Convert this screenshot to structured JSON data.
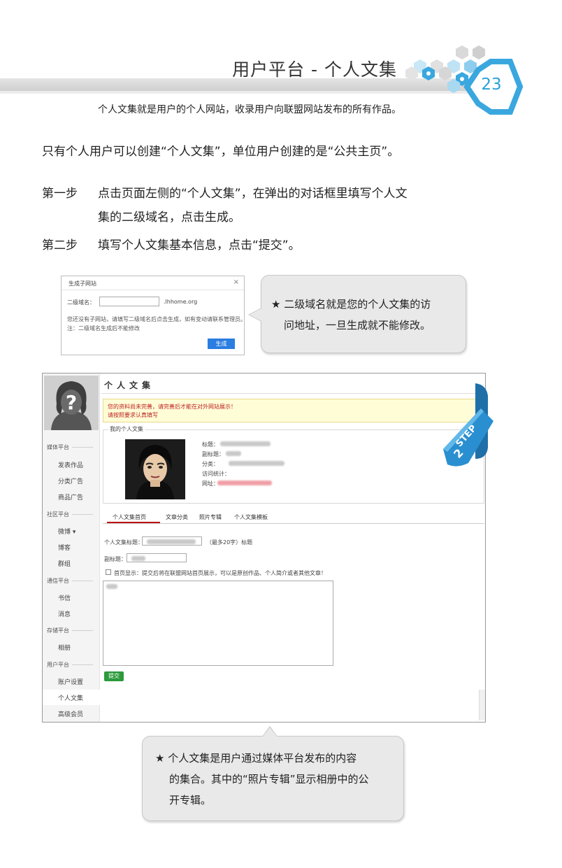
{
  "header": {
    "title": "用户平台 - 个人文集",
    "page_number": "23",
    "subtitle": "个人文集就是用户的个人网站，收录用户向联盟网站发布的所有作品。",
    "accent_color": "#2a9fd9"
  },
  "body": {
    "intro": "只有个人用户可以创建“个人文集”，单位用户创建的是“公共主页”。",
    "step1_label": "第一步",
    "step1_line1": "点击页面左侧的“个人文集”，在弹出的对话框里填写个人文",
    "step1_line2": "集的二级域名，点击生成。",
    "step2_label": "第二步",
    "step2_text": "填写个人文集基本信息，点击“提交”。"
  },
  "dialog": {
    "title": "生成子网站",
    "close": "×",
    "field_label": "二级域名：",
    "suffix": ".lhhome.org",
    "tip_line1": "您还没有子网站，请填写二级域名后点击生成，如有变动请联系管理员。",
    "tip_line2": "注：二级域名生成后不能修改",
    "button": "生成"
  },
  "callout1": {
    "line1": "★ 二级域名就是您的个人文集的访",
    "line2": "问地址，一旦生成就不能修改。"
  },
  "callout2": {
    "line1": "★ 个人文集是用户通过媒体平台发布的内容",
    "line2": "的集合。其中的“照片专辑”显示相册中的公",
    "line3": "开专辑。"
  },
  "sidebar": {
    "groups": [
      {
        "title": "媒体平台",
        "items": [
          "发表作品",
          "分类广告",
          "商品广告"
        ]
      },
      {
        "title": "社区平台",
        "items": [
          "微博 ▾",
          "博客",
          "群组"
        ]
      },
      {
        "title": "通信平台",
        "items": [
          "书信",
          "消息"
        ]
      },
      {
        "title": "存储平台",
        "items": [
          "相册"
        ]
      },
      {
        "title": "用户平台",
        "items": [
          "账户设置",
          "个人文集",
          "高级会员"
        ]
      }
    ]
  },
  "main": {
    "title": "个人文集",
    "warning_line1": "您的资料尚未完善，请完善后才能在对外网站展示！",
    "warning_line2": "请按照要求认真填写",
    "info_legend": "我的个人文集",
    "info_labels": [
      "标题：",
      "副标题：",
      "分类：",
      "访问统计：",
      "网址："
    ],
    "tabs": [
      "个人文集首页",
      "文章分类",
      "照片专辑",
      "个人文集模板"
    ],
    "form_title_label": "个人文集标题：",
    "form_title_hint": "（最多20字）标题",
    "form_subtitle_label": "副标题：",
    "checkbox_label": "首页显示：提交后将在联盟网站首页展示，可以是原创作品、个人简介或者其他文章！",
    "submit": "提交"
  },
  "ribbon": {
    "word": "STEP",
    "number": "2",
    "color": "#2a8fd0"
  }
}
